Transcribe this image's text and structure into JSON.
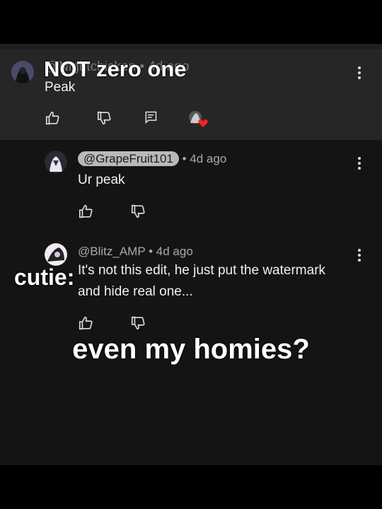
{
  "comments": [
    {
      "handle": "@Nightchicken",
      "time": "4d ago",
      "text": "Peak"
    },
    {
      "handle": "@GrapeFruit101",
      "time": "4d ago",
      "text": "Ur peak"
    },
    {
      "handle": "@Blitz_AMP",
      "time": "4d ago",
      "text_line1": "It's not this edit, he just put the watermark",
      "text_line2": "and hide real one..."
    }
  ],
  "overlay": {
    "top": "NOT zero one",
    "cutie": "cutie:",
    "bottom": "even my homies?"
  },
  "icons": [
    "like-icon",
    "dislike-icon",
    "reply-icon",
    "creator-heart-icon",
    "more-vert-icon"
  ],
  "colors": {
    "background": "#141414",
    "highlight": "#262626",
    "pill": "#b9b9b9",
    "heart": "#ff2020"
  }
}
